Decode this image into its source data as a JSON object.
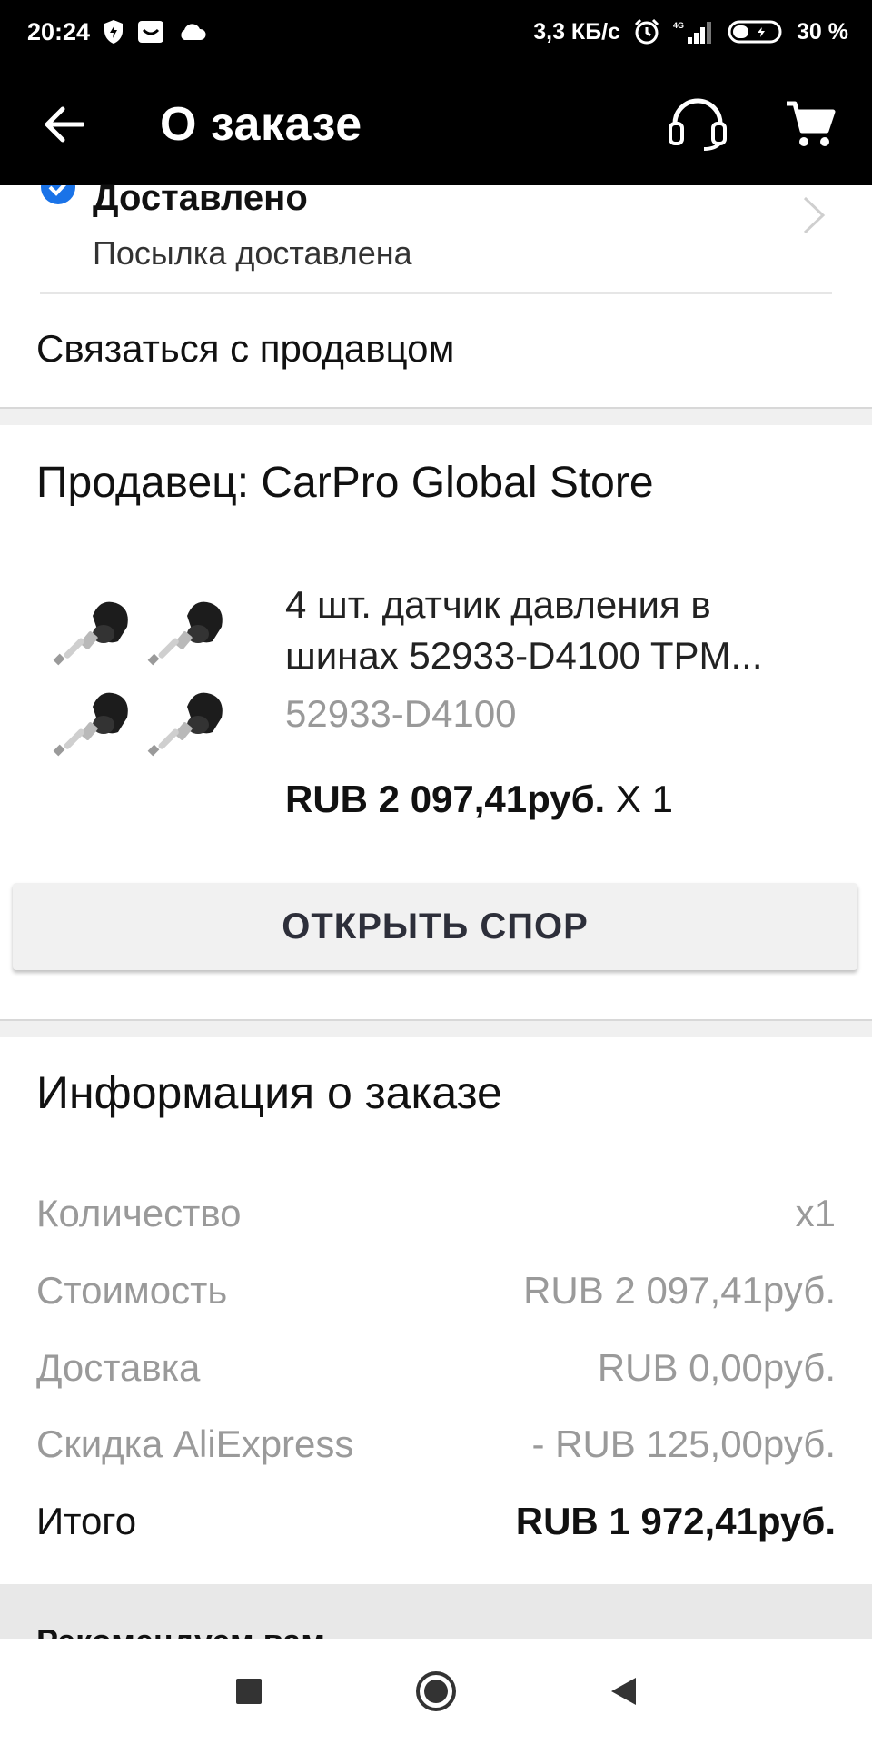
{
  "status_bar": {
    "time": "20:24",
    "network_speed": "3,3 КБ/с",
    "battery_percent": "30 %",
    "icons": [
      "shield-icon",
      "mail-icon",
      "cloud-icon",
      "alarm-icon",
      "signal-icon",
      "battery-icon"
    ]
  },
  "app_bar": {
    "title": "О заказе",
    "icons": [
      "back-arrow-icon",
      "support-headset-icon",
      "cart-icon"
    ]
  },
  "order_status": {
    "title": "Доставлено",
    "subtitle": "Посылка доставлена",
    "contact_seller": "Связаться с продавцом"
  },
  "seller": {
    "label": "Продавец: CarPro Global Store"
  },
  "product": {
    "title": "4 шт. датчик давления в шинах 52933-D4100 TPM...",
    "sku": "52933-D4100",
    "price": "RUB 2 097,41руб.",
    "quantity": "X 1"
  },
  "dispute_button": "ОТКРЫТЬ СПОР",
  "order_info": {
    "title": "Информация о заказе",
    "rows": [
      {
        "label": "Количество",
        "value": "x1"
      },
      {
        "label": "Стоимость",
        "value": "RUB 2 097,41руб."
      },
      {
        "label": "Доставка",
        "value": "RUB 0,00руб."
      },
      {
        "label": "Скидка AliExpress",
        "value": "- RUB 125,00руб."
      },
      {
        "label": "Итого",
        "value": "RUB 1 972,41руб."
      }
    ]
  },
  "recommend": {
    "title": "Рекомендуем вам"
  },
  "colors": {
    "bar_background": "#000000",
    "check_blue": "#1a73e8",
    "muted_text": "#9a9a9a",
    "button_text": "#2d2f3a"
  }
}
